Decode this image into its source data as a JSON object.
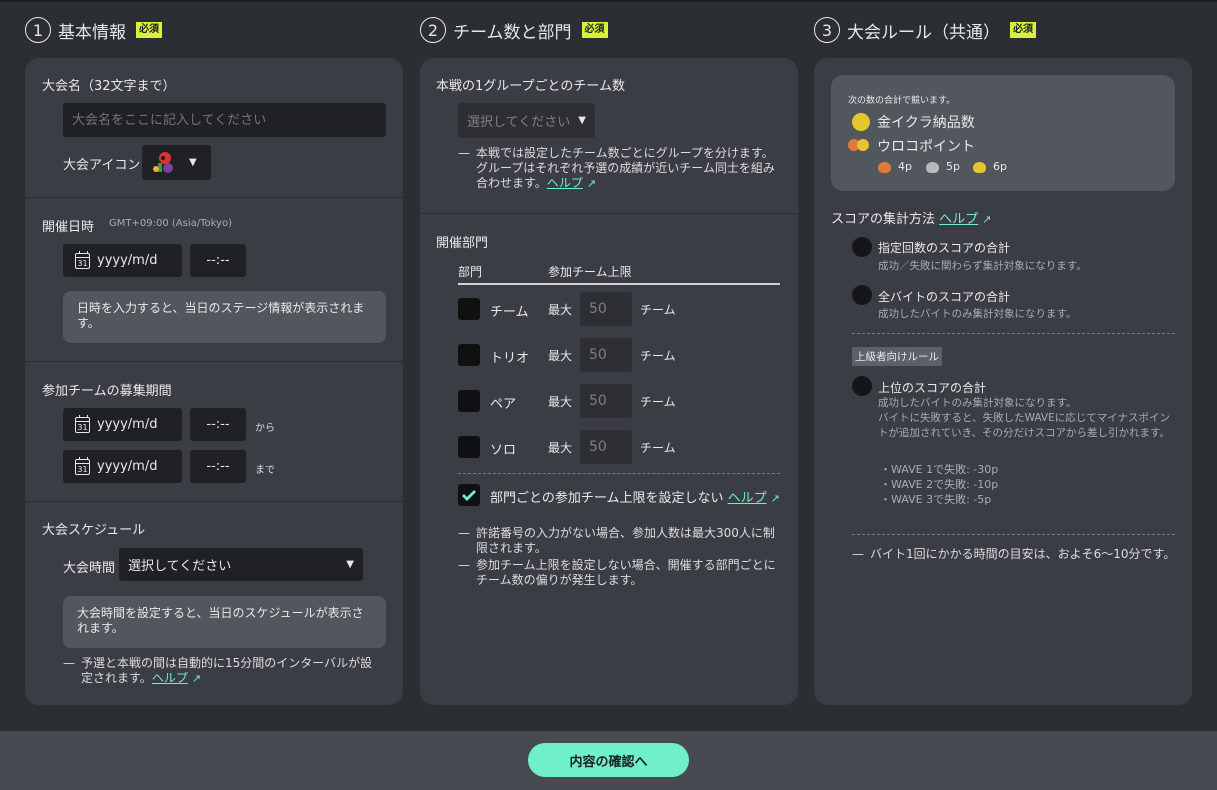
{
  "sections": {
    "s1": {
      "num": "1",
      "title": "基本情報",
      "badge": "必須"
    },
    "s2": {
      "num": "2",
      "title": "チーム数と部門",
      "badge": "必須"
    },
    "s3": {
      "num": "3",
      "title": "大会ルール（共通）",
      "badge": "必須"
    }
  },
  "basic": {
    "name_label": "大会名（32文字まで）",
    "name_placeholder": "大会名をここに記入してください",
    "icon_label": "大会アイコン",
    "datetime_label": "開催日時",
    "timezone": "GMT+09:00 (Asia/Tokyo)",
    "date_placeholder": "yyyy/m/d",
    "time_placeholder": "--:--",
    "datetime_info": "日時を入力すると、当日のステージ情報が表示されます。",
    "recruit_label": "参加チームの募集期間",
    "from": "から",
    "to": "まで",
    "schedule_label": "大会スケジュール",
    "duration_label": "大会時間",
    "duration_value": "選択してください",
    "schedule_info": "大会時間を設定すると、当日のスケジュールが表示されます。",
    "schedule_note": "予選と本戦の間は自動的に15分間のインターバルが設定されます。",
    "help": "ヘルプ"
  },
  "teams": {
    "group_label": "本戦の1グループごとのチーム数",
    "group_select": "選択してください",
    "group_note": "本戦では設定したチーム数ごとにグループを分けます。グループはそれぞれ予選の成績が近いチーム同士を組み合わせます。",
    "help": "ヘルプ",
    "divisions_label": "開催部門",
    "col_division": "部門",
    "col_limit": "参加チーム上限",
    "max": "最大",
    "unit": "チーム",
    "divisions": [
      {
        "name": "チーム",
        "limit": "50"
      },
      {
        "name": "トリオ",
        "limit": "50"
      },
      {
        "name": "ペア",
        "limit": "50"
      },
      {
        "name": "ソロ",
        "limit": "50"
      }
    ],
    "no_limit_label": "部門ごとの参加チーム上限を設定しない",
    "note1": "許諾番号の入力がない場合、参加人数は最大300人に制限されます。",
    "note2": "参加チーム上限を設定しない場合、開催する部門ごとにチーム数の偏りが発生します。"
  },
  "rules": {
    "sum_caption": "次の数の合計で競います。",
    "golden": "金イクラ納品数",
    "scale": "ウロコポイント",
    "points": [
      "4p",
      "5p",
      "6p"
    ],
    "score_method": "スコアの集計方法",
    "help": "ヘルプ",
    "opt1_title": "指定回数のスコアの合計",
    "opt1_desc": "成功／失敗に関わらず集計対象になります。",
    "opt2_title": "全バイトのスコアの合計",
    "opt2_desc": "成功したバイトのみ集計対象になります。",
    "advanced": "上級者向けルール",
    "opt3_title": "上位のスコアの合計",
    "opt3_desc": "成功したバイトのみ集計対象になります。\nバイトに失敗すると、失敗したWAVEに応じてマイナスポイントが追加されていき、その分だけスコアから差し引かれます。",
    "penalties": [
      "WAVE 1で失敗: -30p",
      "WAVE 2で失敗: -10p",
      "WAVE 3で失敗:   -5p"
    ],
    "time_note": "バイト1回にかかる時間の目安は、およそ6〜10分です。"
  },
  "submit": "内容の確認へ",
  "colors": {
    "accent": "#6ff0c8",
    "badge": "#d8f23a",
    "card": "#3a3d43",
    "bg": "#2b2e33"
  }
}
